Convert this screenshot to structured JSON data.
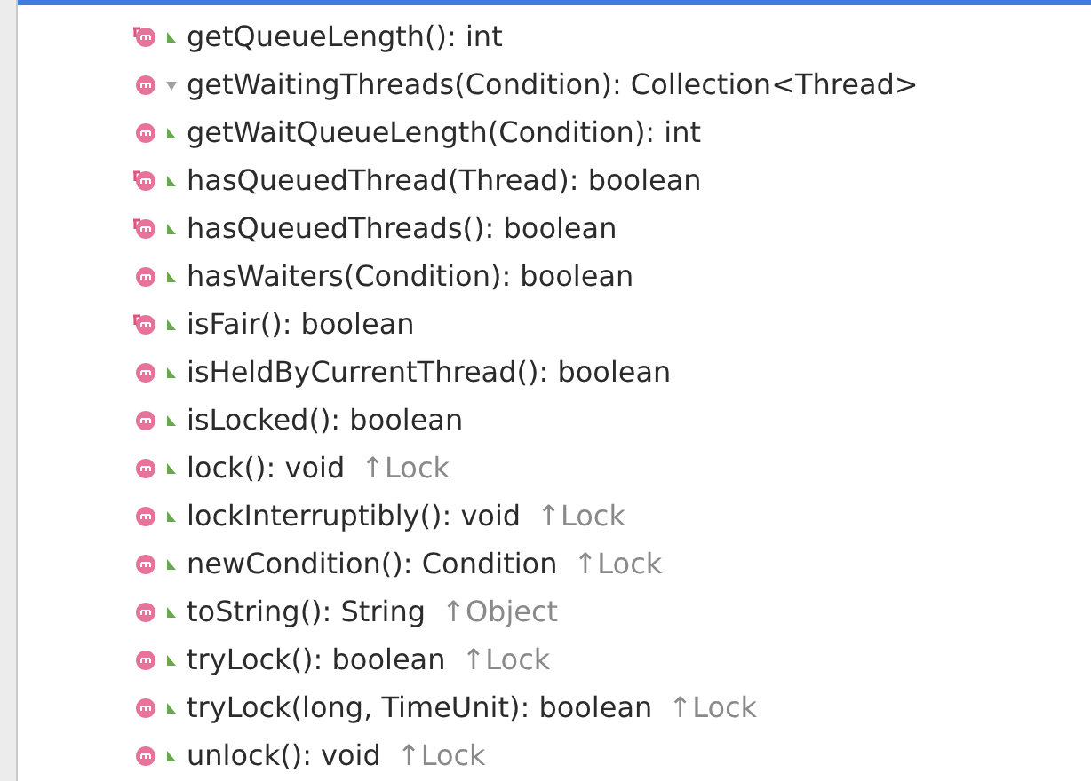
{
  "members": [
    {
      "signature": "getQueueLength(): int",
      "kind": "final-method",
      "public": true
    },
    {
      "signature": "getWaitingThreads(Condition): Collection<Thread>",
      "kind": "method",
      "public": false
    },
    {
      "signature": "getWaitQueueLength(Condition): int",
      "kind": "method",
      "public": true
    },
    {
      "signature": "hasQueuedThread(Thread): boolean",
      "kind": "final-method",
      "public": true
    },
    {
      "signature": "hasQueuedThreads(): boolean",
      "kind": "final-method",
      "public": true
    },
    {
      "signature": "hasWaiters(Condition): boolean",
      "kind": "method",
      "public": true
    },
    {
      "signature": "isFair(): boolean",
      "kind": "final-method",
      "public": true
    },
    {
      "signature": "isHeldByCurrentThread(): boolean",
      "kind": "method",
      "public": true
    },
    {
      "signature": "isLocked(): boolean",
      "kind": "method",
      "public": true
    },
    {
      "signature": "lock(): void",
      "inherited": "↑Lock",
      "kind": "method",
      "public": true
    },
    {
      "signature": "lockInterruptibly(): void",
      "inherited": "↑Lock",
      "kind": "method",
      "public": true
    },
    {
      "signature": "newCondition(): Condition",
      "inherited": "↑Lock",
      "kind": "method",
      "public": true
    },
    {
      "signature": "toString(): String",
      "inherited": "↑Object",
      "kind": "method",
      "public": true
    },
    {
      "signature": "tryLock(): boolean",
      "inherited": "↑Lock",
      "kind": "method",
      "public": true
    },
    {
      "signature": "tryLock(long, TimeUnit): boolean",
      "inherited": "↑Lock",
      "kind": "method",
      "public": true
    },
    {
      "signature": "unlock(): void",
      "inherited": "↑Lock",
      "kind": "method",
      "public": true
    }
  ]
}
